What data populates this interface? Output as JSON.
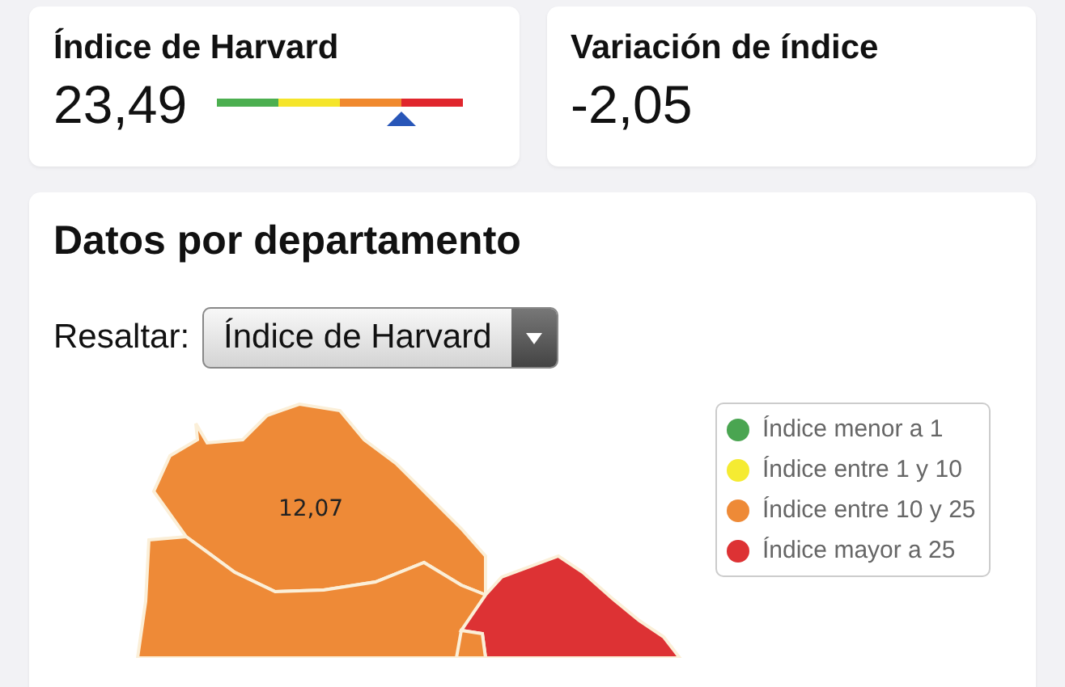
{
  "stats": [
    {
      "title": "Índice de Harvard",
      "value": "23,49",
      "scale": {
        "segments": [
          {
            "color": "#4caf50"
          },
          {
            "color": "#f5e52a"
          },
          {
            "color": "#f0892e"
          },
          {
            "color": "#e0262d"
          }
        ],
        "level": 0.75
      }
    },
    {
      "title": "Variación de índice",
      "value": "-2,05"
    }
  ],
  "section": {
    "title": "Datos por departamento",
    "highlight_label": "Resaltar:",
    "dropdown_value": "Índice de Harvard",
    "legend": [
      {
        "label": "Índice menor a 1",
        "color": "#4aa551"
      },
      {
        "label": "Índice entre 1 y 10",
        "color": "#f5eb32"
      },
      {
        "label": "Índice entre 10 y 25",
        "color": "#ee8a37"
      },
      {
        "label": "Índice mayor a 25",
        "color": "#dd3234"
      }
    ],
    "regions": [
      {
        "color": "#ee8a37",
        "label": "12,07"
      },
      {
        "color": "#ee8a37"
      },
      {
        "color": "#dd3234"
      },
      {
        "color": "#ee8a37"
      }
    ]
  }
}
